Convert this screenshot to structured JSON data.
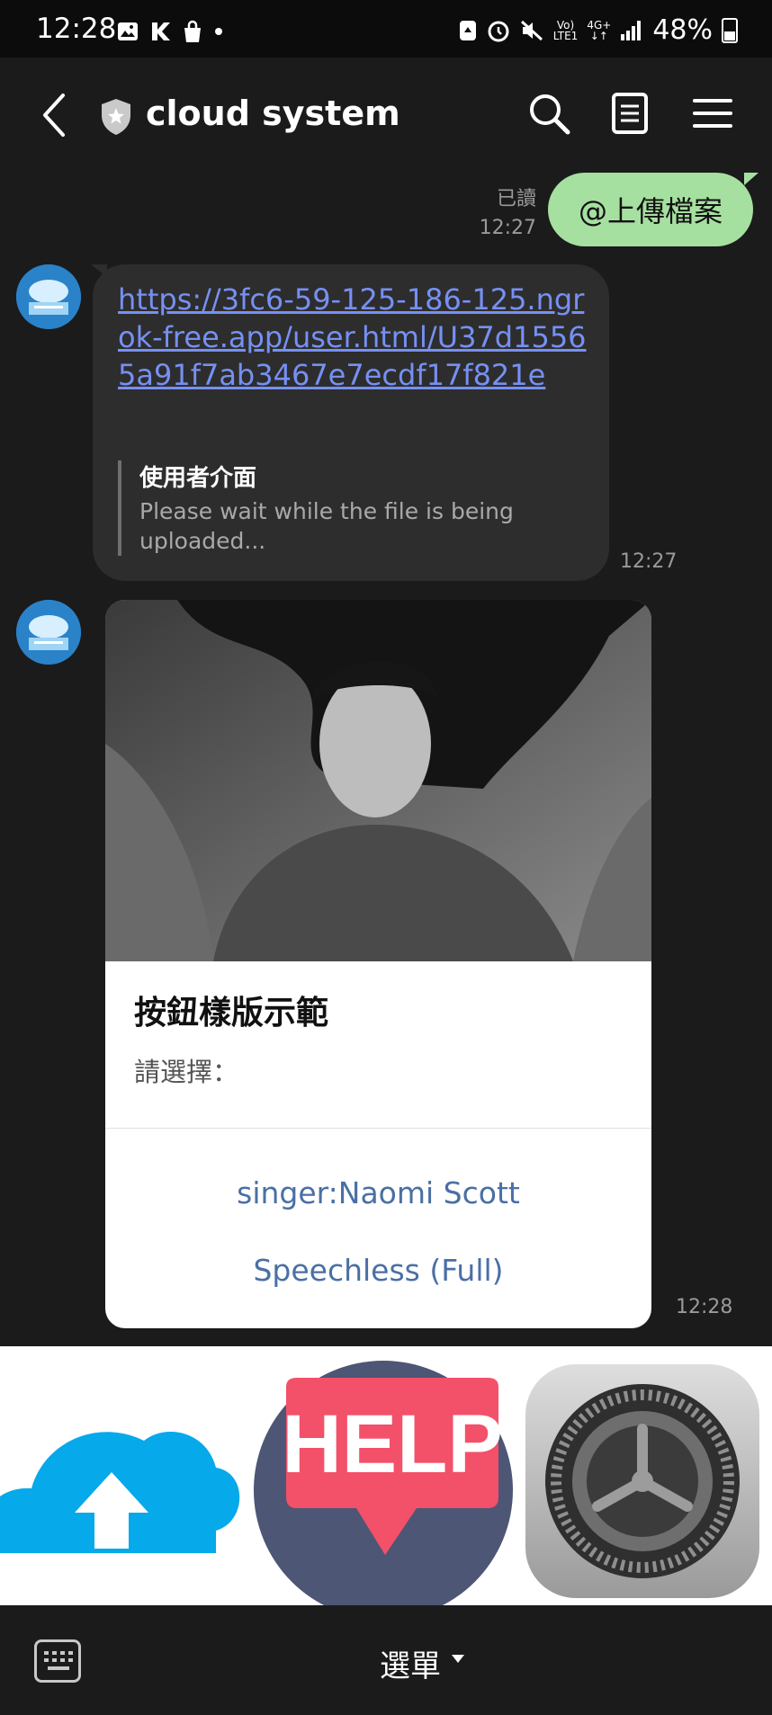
{
  "status_bar": {
    "time": "12:28",
    "battery": "48%",
    "net_top": "Vo)",
    "net_bottom": "LTE1",
    "net2": "4G+"
  },
  "header": {
    "title": "cloud system"
  },
  "messages": {
    "sent": {
      "text": "@上傳檔案",
      "read_label": "已讀",
      "time": "12:27"
    },
    "bot1": {
      "link": "https://3fc6-59-125-186-125.ngrok-free.app/user.html/U37d15565a91f7ab3467e7ecdf17f821e",
      "quote_title": "使用者介面",
      "quote_body": "Please wait while the file is being uploaded...",
      "time": "12:27"
    },
    "bot2": {
      "card_title": "按鈕樣版示範",
      "card_subtitle": "請選擇：",
      "buttons": [
        "singer:Naomi Scott",
        "Speechless (Full)"
      ],
      "time": "12:28"
    }
  },
  "rich_menu": {
    "help_text": "HELP",
    "icons": [
      "cloud-upload-icon",
      "help-icon",
      "settings-gear-icon"
    ]
  },
  "bottom_bar": {
    "menu_label": "選單"
  },
  "colors": {
    "sent_bubble": "#a6e0a0",
    "received_bubble": "#2d2d2d",
    "link": "#7690f3",
    "card_button": "#4a6fa5"
  }
}
